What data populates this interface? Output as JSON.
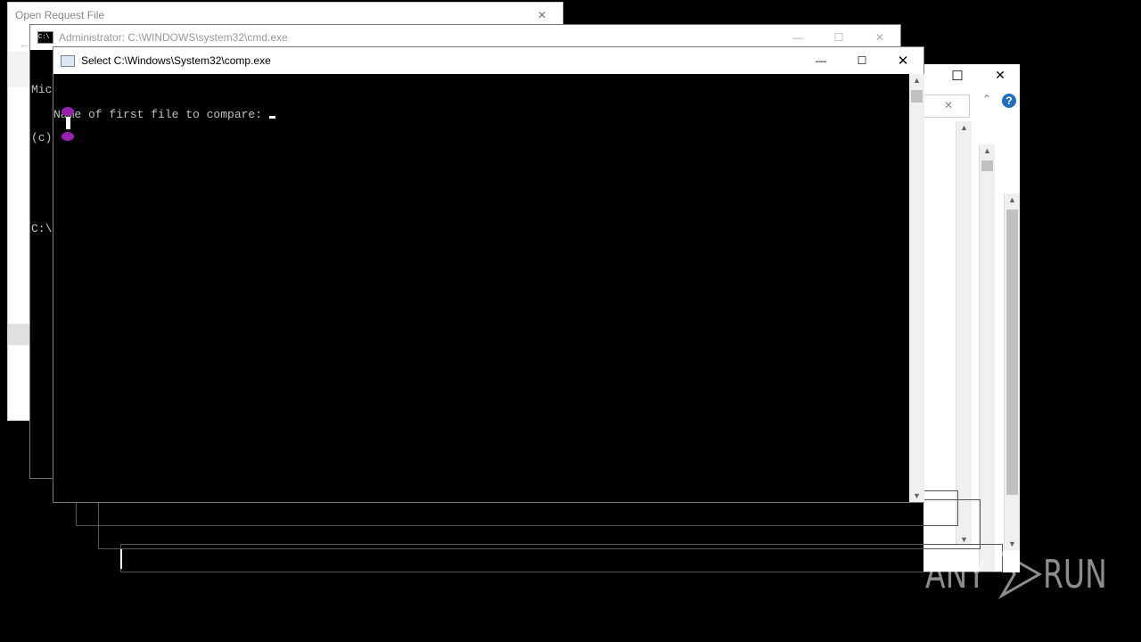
{
  "windows": {
    "open_request": {
      "title": "Open Request File"
    },
    "cmd": {
      "title": "Administrator: C:\\WINDOWS\\system32\\cmd.exe",
      "line1": "Mic",
      "line2": "(c)",
      "line3": "C:\\"
    },
    "comp": {
      "title": "Select C:\\Windows\\System32\\comp.exe",
      "prompt": "Name of first file to compare: "
    }
  },
  "controls": {
    "minimize": "—",
    "maximize": "☐",
    "close": "✕",
    "help": "?"
  },
  "watermark": {
    "text_left": "ANY",
    "text_right": "RUN"
  }
}
